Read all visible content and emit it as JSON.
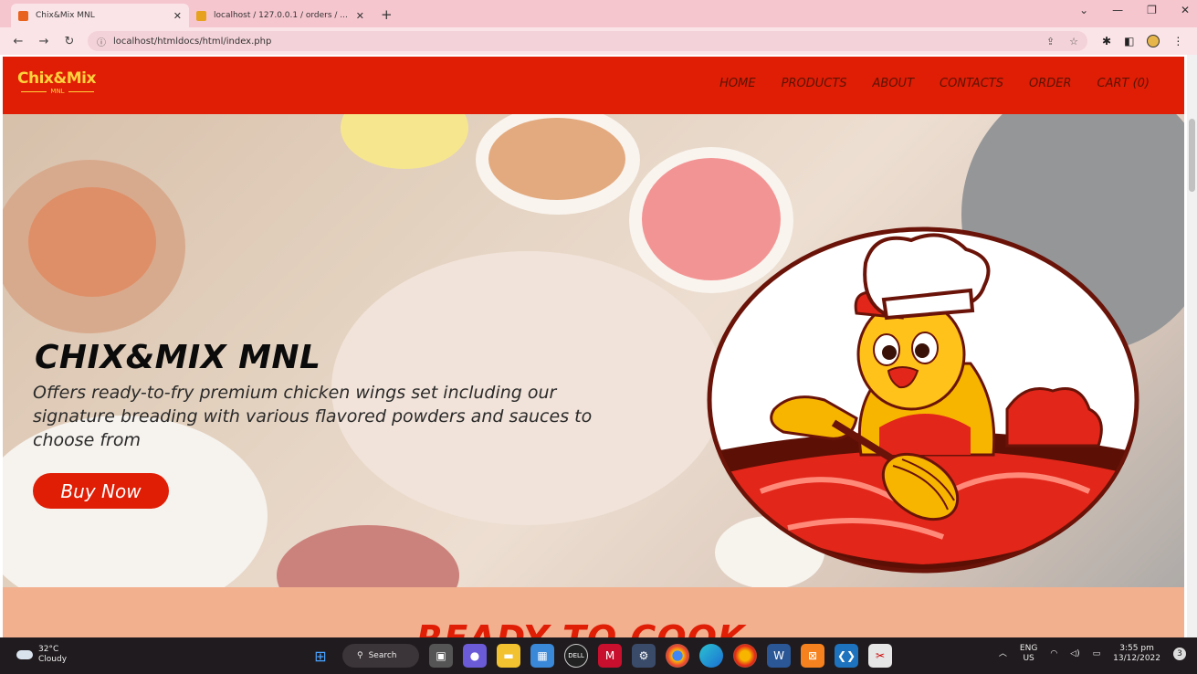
{
  "browser": {
    "tabs": [
      {
        "title": "Chix&Mix MNL",
        "active": true,
        "favicon_color": "#e8641e"
      },
      {
        "title": "localhost / 127.0.0.1 / orders / ...",
        "active": false,
        "favicon_color": "#e6a21e"
      }
    ],
    "url": "localhost/htmldocs/html/index.php",
    "window_controls": [
      "chevron-down-icon",
      "minimize-icon",
      "restore-icon",
      "close-icon"
    ]
  },
  "site": {
    "logo": {
      "main": "Chix&Mix",
      "sub": "MNL"
    },
    "nav": [
      "HOME",
      "PRODUCTS",
      "ABOUT",
      "CONTACTS",
      "ORDER",
      "CART (0)"
    ],
    "hero": {
      "title": "CHIX&MIX MNL",
      "description": "Offers ready-to-fry premium chicken wings set including our signature breading with various flavored powders and sauces to choose from",
      "cta": "Buy Now"
    },
    "section_title": "READY TO COOK"
  },
  "colors": {
    "brand_red": "#e01d05",
    "brand_yellow": "#ffd23c",
    "section_bg": "#f2b08f"
  },
  "taskbar": {
    "weather": {
      "temp": "32°C",
      "condition": "Cloudy"
    },
    "search": "Search",
    "language": {
      "line1": "ENG",
      "line2": "US"
    },
    "clock": {
      "time": "3:55 pm",
      "date": "13/12/2022"
    },
    "notification_count": "3"
  }
}
